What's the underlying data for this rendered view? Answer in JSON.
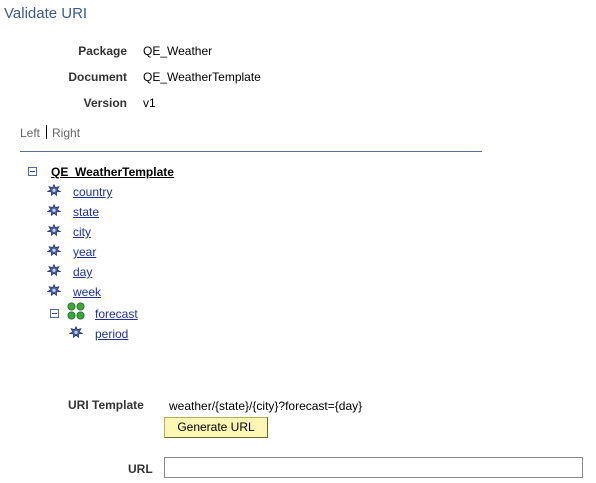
{
  "page": {
    "title": "Validate URI"
  },
  "info": {
    "package_label": "Package",
    "package_value": "QE_Weather",
    "document_label": "Document",
    "document_value": "QE_WeatherTemplate",
    "version_label": "Version",
    "version_value": "v1"
  },
  "layout_links": {
    "left": "Left",
    "right": "Right"
  },
  "tree": {
    "root": "QE_WeatherTemplate",
    "children": [
      "country",
      "state",
      "city",
      "year",
      "day",
      "week"
    ],
    "group": {
      "label": "forecast",
      "children": [
        "period"
      ]
    }
  },
  "uri_template": {
    "label": "URI Template",
    "value": "weather/{state}/{city}?forecast={day}",
    "button_label": "Generate URL"
  },
  "url": {
    "label": "URL",
    "value": ""
  },
  "colors": {
    "title": "#3a5a8c",
    "link": "#1f2fa0",
    "button_bg": "#fdf7b4",
    "divider": "#5a6f94"
  }
}
